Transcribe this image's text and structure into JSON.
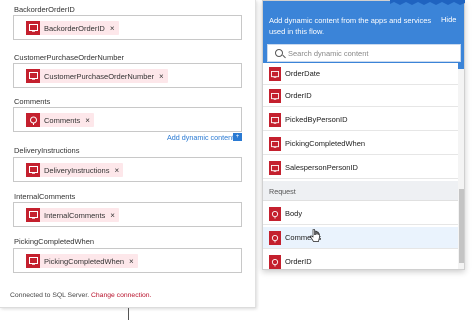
{
  "fields": [
    {
      "label": "BackorderOrderID",
      "token": "BackorderOrderID",
      "icon": "sql-table-icon"
    },
    {
      "label": "CustomerPurchaseOrderNumber",
      "token": "CustomerPurchaseOrderNumber",
      "icon": "sql-table-icon"
    },
    {
      "label": "Comments",
      "token": "Comments",
      "icon": "request-icon"
    },
    {
      "label": "DeliveryInstructions",
      "token": "DeliveryInstructions",
      "icon": "sql-table-icon"
    },
    {
      "label": "InternalComments",
      "token": "InternalComments",
      "icon": "sql-table-icon"
    },
    {
      "label": "PickingCompletedWhen",
      "token": "PickingCompletedWhen",
      "icon": "sql-table-icon"
    }
  ],
  "add_dynamic_content": "Add dynamic content",
  "footer": {
    "prefix": "Connected to SQL Server.",
    "link": "Change connection."
  },
  "popup": {
    "header": "Add dynamic content from the apps and services used in this flow.",
    "hide": "Hide",
    "search_placeholder": "Search dynamic content",
    "items_top": [
      "OrderDate",
      "OrderID",
      "PickedByPersonID",
      "PickingCompletedWhen",
      "SalespersonPersonID"
    ],
    "group_label": "Request",
    "items_request": [
      "Body",
      "Comments",
      "OrderID"
    ],
    "highlighted_item": "Comments"
  },
  "colors": {
    "accent_blue": "#3b84d8",
    "token_red": "#c4202e",
    "token_bg": "#fde7ea",
    "link_blue": "#2a7ad3"
  }
}
